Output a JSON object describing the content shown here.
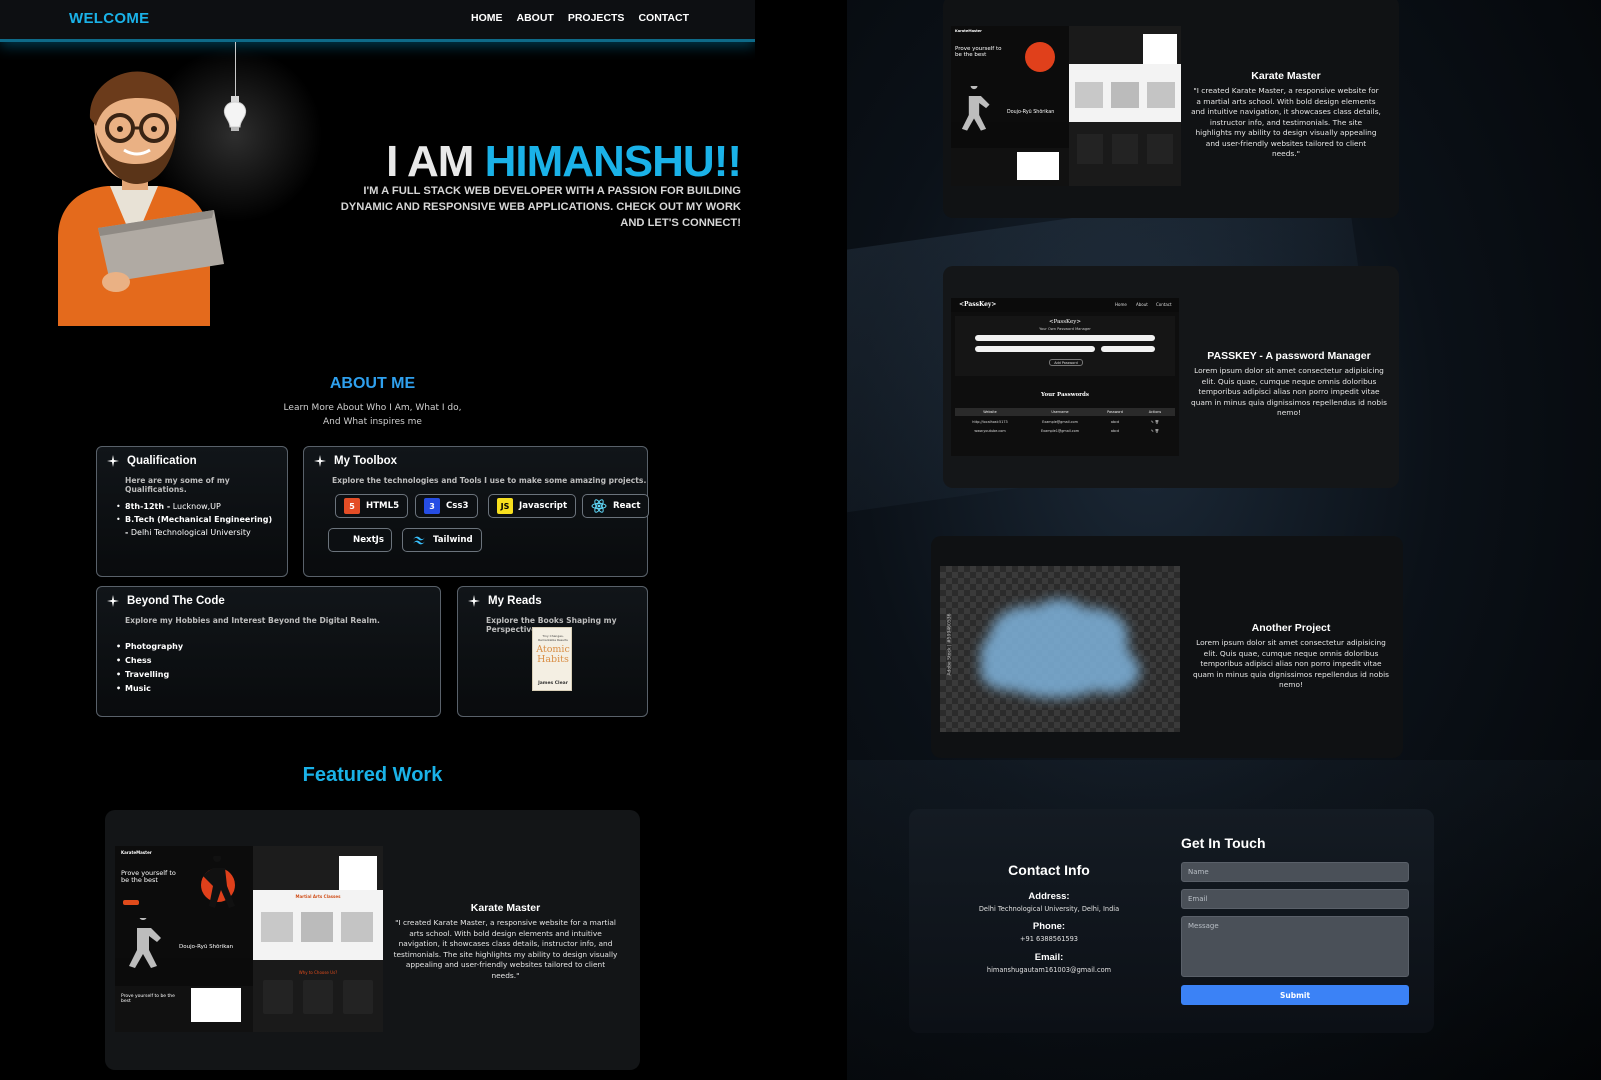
{
  "nav": {
    "brand": "WELCOME",
    "links": [
      "HOME",
      "ABOUT",
      "PROJECTS",
      "CONTACT"
    ]
  },
  "hero": {
    "title_prefix": "I AM ",
    "title_name": "HIMANSHU!!",
    "subtitle": "I'M A FULL STACK WEB DEVELOPER WITH A PASSION FOR BUILDING DYNAMIC AND RESPONSIVE WEB APPLICATIONS. CHECK OUT MY WORK AND LET'S CONNECT!"
  },
  "about": {
    "heading": "ABOUT ME",
    "subheading_line1": "Learn More About Who I Am, What I do,",
    "subheading_line2": "And What inspires me",
    "qualification": {
      "title": "Qualification",
      "subtitle": "Here are my some of my Qualifications.",
      "items": [
        {
          "bold": "8th-12th -",
          "text": " Lucknow,UP"
        },
        {
          "bold": "B.Tech (Mechanical Engineering) -",
          "text": " Delhi Technological University"
        }
      ]
    },
    "toolbox": {
      "title": "My Toolbox",
      "subtitle": "Explore the technologies and Tools I use to make some amazing projects.",
      "tools": [
        "HTML5",
        "Css3",
        "Javascript",
        "React",
        "NextJs",
        "Tailwind"
      ]
    },
    "beyond": {
      "title": "Beyond The Code",
      "subtitle": "Explore my Hobbies and Interest Beyond the Digital Realm.",
      "items": [
        "Photography",
        "Chess",
        "Travelling",
        "Music"
      ]
    },
    "reads": {
      "title": "My Reads",
      "subtitle": "Explore the Books Shaping my Perspective.",
      "book_tagline": "Tiny Changes, Remarkable Results",
      "book_title": "Atomic Habits",
      "book_author": "James Clear"
    }
  },
  "featured": {
    "heading": "Featured Work",
    "projects": [
      {
        "title": "Karate Master",
        "description": "\"I created Karate Master, a responsive website for a martial arts school. With bold design elements and intuitive navigation, it showcases class details, instructor info, and testimonials. The site highlights my ability to design visually appealing and user-friendly websites tailored to client needs.\""
      },
      {
        "title": "PASSKEY - A password Manager",
        "description": "Lorem ipsum dolor sit amet consectetur adipisicing elit. Quis quae, cumque neque omnis doloribus temporibus adipisci alias non porro impedit vitae quam in minus quia dignissimos repellendus id nobis nemo!"
      },
      {
        "title": "Another Project",
        "description": "Lorem ipsum dolor sit amet consectetur adipisicing elit. Quis quae, cumque neque omnis doloribus temporibus adipisci alias non porro impedit vitae quam in minus quia dignissimos repellendus id nobis nemo!"
      }
    ]
  },
  "karate_shot": {
    "brand": "KarateMaster",
    "hero": "Prove yourself to be the best",
    "dojo": "Doujo-Ryū Shōrikan",
    "classes": "Martial Arts Classes",
    "why": "Why to Choose Us?"
  },
  "passkey_shot": {
    "logo": "<PassKey>",
    "nav": [
      "Home",
      "About",
      "Contact"
    ],
    "tagline": "Your Own Password Manager",
    "save": "Add Password",
    "table_title": "Your Passwords",
    "columns": [
      "Website",
      "Username",
      "Password",
      "Actions"
    ],
    "rows": [
      [
        "http://localhost:5173",
        "Example@gmail.com",
        "abcd"
      ],
      [
        "www.youtube.com",
        "Example1@gmail.com",
        "abcd"
      ]
    ]
  },
  "another_shot": {
    "watermark": "Adobe Stock | #599460536"
  },
  "contact": {
    "info_heading": "Contact Info",
    "address_label": "Address:",
    "address": "Delhi Technological University, Delhi, India",
    "phone_label": "Phone:",
    "phone": "+91 6388561593",
    "email_label": "Email:",
    "email": "himanshugautam161003@gmail.com",
    "form_heading": "Get In Touch",
    "name_placeholder": "Name",
    "email_placeholder": "Email",
    "message_placeholder": "Message",
    "submit": "Submit"
  },
  "colors": {
    "accent": "#1ab2e8",
    "about_heading": "#2fa0ee",
    "submit": "#3b82f6"
  }
}
